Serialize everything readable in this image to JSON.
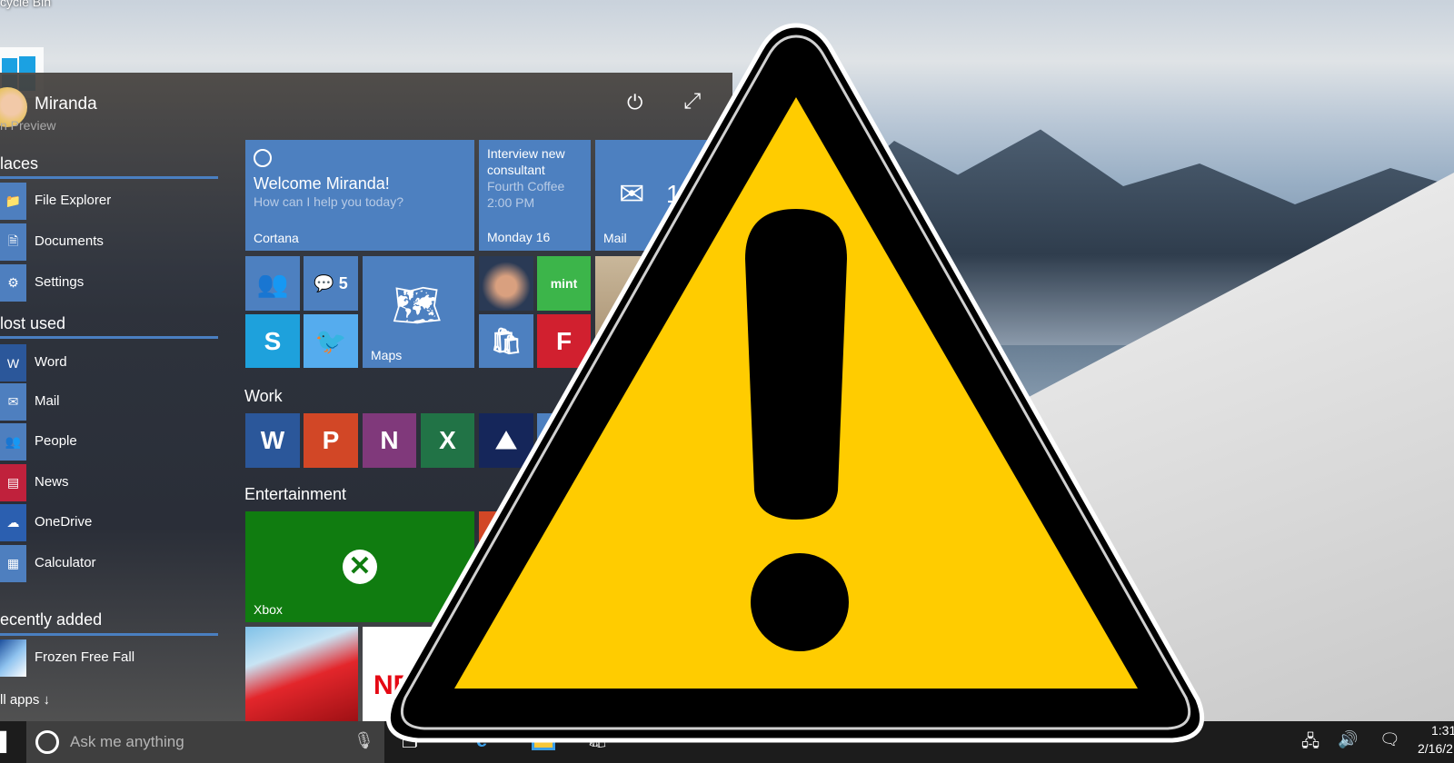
{
  "desktop": {
    "recycle_bin_label": "cycle Bin",
    "preview_label": "n Preview"
  },
  "start": {
    "user": "Miranda",
    "sections": {
      "places": "laces",
      "most_used": "lost used",
      "recently_added": "ecently added"
    },
    "places": [
      {
        "label": "File Explorer",
        "icon": "folder-icon"
      },
      {
        "label": "Documents",
        "icon": "documents-icon"
      },
      {
        "label": "Settings",
        "icon": "gear-icon"
      }
    ],
    "most_used": [
      {
        "label": "Word",
        "icon": "word-icon",
        "color": "#2b579a"
      },
      {
        "label": "Mail",
        "icon": "mail-icon",
        "color": "#4e7fbf"
      },
      {
        "label": "People",
        "icon": "people-icon",
        "color": "#4e7fbf"
      },
      {
        "label": "News",
        "icon": "news-icon",
        "color": "#c0213c"
      },
      {
        "label": "OneDrive",
        "icon": "cloud-icon",
        "color": "#2b5fb0"
      },
      {
        "label": "Calculator",
        "icon": "calculator-icon",
        "color": "#4e7fbf"
      }
    ],
    "recent": [
      {
        "label": "Frozen Free Fall"
      }
    ],
    "all_apps": "ll apps",
    "tiles": {
      "cortana": {
        "title": "Welcome Miranda!",
        "subtitle": "How can I help you today?",
        "name": "Cortana"
      },
      "calendar": {
        "line1": "Interview new",
        "line2": "consultant",
        "line3": "Fourth Coffee",
        "line4": "2:00 PM",
        "name": "Monday 16"
      },
      "mail": {
        "name": "Mail",
        "count": "10"
      },
      "messaging_count": "5",
      "maps": "Maps",
      "mint": "mint",
      "work_label": "Work",
      "entertainment_label": "Entertainment",
      "xbox": "Xbox",
      "netflix": "NE"
    }
  },
  "taskbar": {
    "search_placeholder": "Ask me anything",
    "time": "1:31",
    "date": "2/16/2"
  },
  "warning": {
    "fill": "#ffcc00",
    "stroke": "#000000"
  }
}
